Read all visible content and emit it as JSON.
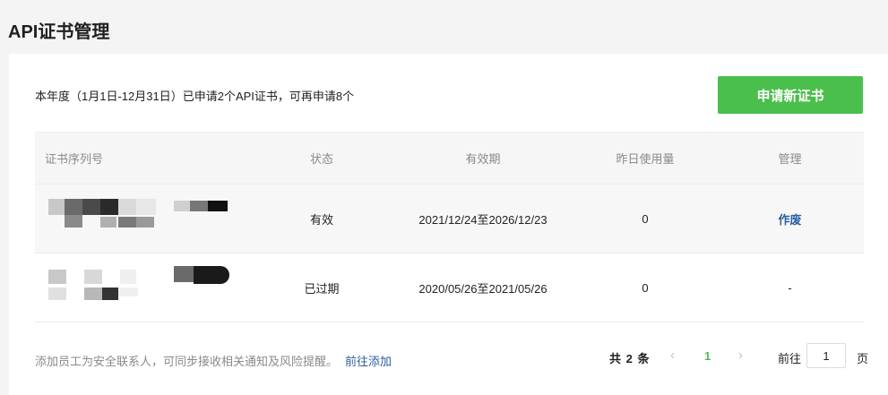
{
  "page": {
    "title": "API证书管理"
  },
  "summary": {
    "quota_text": "本年度（1月1日-12月31日）已申请2个API证书，可再申请8个",
    "apply_button": "申请新证书"
  },
  "table": {
    "columns": [
      "证书序列号",
      "状态",
      "有效期",
      "昨日使用量",
      "管理"
    ],
    "rows": [
      {
        "serial": "",
        "status": "有效",
        "validity": "2021/12/24至2026/12/23",
        "usage": "0",
        "action": "作废"
      },
      {
        "serial": "",
        "status": "已过期",
        "validity": "2020/05/26至2021/05/26",
        "usage": "0",
        "action": "-"
      }
    ]
  },
  "footer": {
    "note": "添加员工为安全联系人，可同步接收相关通知及风险提醒。",
    "add_link": "前往添加"
  },
  "pagination": {
    "total": "共 2 条",
    "prev_icon": "‹",
    "current_page": "1",
    "next_icon": "›",
    "goto_label": "前往",
    "goto_value": "1",
    "page_unit": "页"
  },
  "colors": {
    "primary": "#4bbf4b",
    "link": "#2a5d9f"
  }
}
